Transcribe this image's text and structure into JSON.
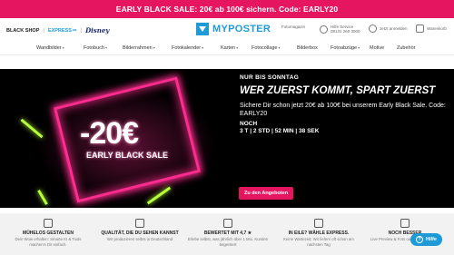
{
  "promo_bar": {
    "text": "EARLY BLACK SALE: 20€ ab 100€ sichern. Code: EARLY20"
  },
  "header": {
    "left_links": {
      "black_shop": "BLACK SHOP",
      "express": "EXPRESS",
      "disney": "Disney"
    },
    "logo_text": "MYPOSTER",
    "utility": {
      "photo_account": "Fotomagazin",
      "help_title": "Hilfe Service",
      "help_phone": "08131 260 3000",
      "login": "Jetzt anmelden",
      "cart": "Warenkorb"
    }
  },
  "nav": [
    {
      "label": "Wandbilder",
      "chev": "▾"
    },
    {
      "label": "Fotobuch",
      "chev": "▾"
    },
    {
      "label": "Bilderrahmen",
      "chev": "▾"
    },
    {
      "label": "Fotokalender",
      "chev": "▾"
    },
    {
      "label": "Karten",
      "chev": "▾"
    },
    {
      "label": "Fotocollage",
      "chev": "▾"
    },
    {
      "label": "Bilderbox",
      "chev": ""
    },
    {
      "label": "Fotoabzüge",
      "chev": "▾"
    },
    {
      "label": "Motive",
      "chev": ""
    },
    {
      "label": "Zubehör",
      "chev": ""
    }
  ],
  "hero": {
    "discount": "-20€",
    "sale_label": "EARLY BLACK SALE",
    "kicker": "NUR BIS SONNTAG",
    "headline": "WER ZUERST KOMMT, SPART ZUERST",
    "body": "Sichere Dir schon jetzt 20€ ab 100€ bei unserem Early Black Sale. Code: EARLY20",
    "countdown_label": "NOCH",
    "countdown": "3 T | 2 STD | 52 MIN | 38 SEK",
    "cta": "Zu den Angeboten"
  },
  "usps": [
    {
      "title": "MÜHELOS GESTALTEN",
      "sub": "Dein Wow erhalten: Smarte KI & Tools machen's Dir einfach."
    },
    {
      "title": "QUALITÄT, DIE DU SEHEN KANNST",
      "sub": "Wir produzieren selbst in Deutschland"
    },
    {
      "title": "BEWERTET MIT 4,7 ★",
      "sub": "Erlebe selbst, was jährlich über 1 Mio. Kunden begeistert"
    },
    {
      "title": "IN EILE? WÄHLE EXPRESS.",
      "sub": "Keine Wartezeit: Wir liefern oft schon am nächsten Tag"
    },
    {
      "title": "NOCH BESSER",
      "sub": "Live Preview & Foto out für einfaches ..."
    }
  ],
  "help_button": "Hilfe"
}
